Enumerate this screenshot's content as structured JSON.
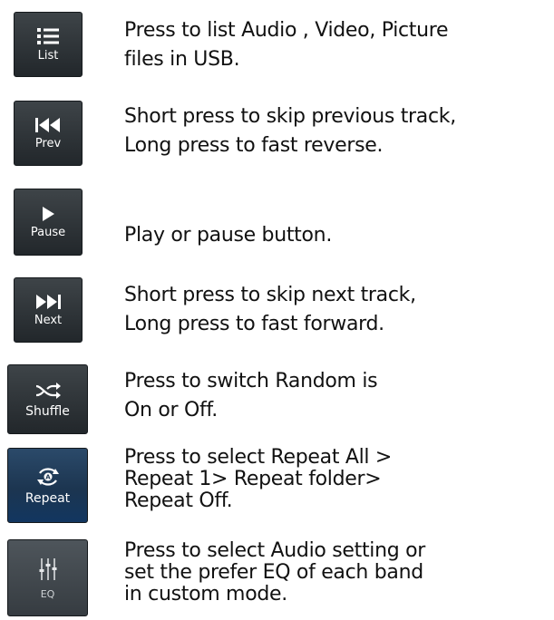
{
  "rows": [
    {
      "label": "List",
      "icon": "list-icon",
      "lines": [
        "Press to list Audio , Video, Picture",
        "files in USB."
      ]
    },
    {
      "label": "Prev",
      "icon": "skip-previous-icon",
      "lines": [
        "Short press to skip previous track,",
        "Long press to fast reverse."
      ]
    },
    {
      "label": "Pause",
      "icon": "play-icon",
      "lines": [
        "Play or pause button."
      ]
    },
    {
      "label": "Next",
      "icon": "skip-next-icon",
      "lines": [
        "Short press to skip next track,",
        "Long press to fast forward."
      ]
    },
    {
      "label": "Shuffle",
      "icon": "shuffle-icon",
      "lines": [
        "Press to switch Random is",
        "On or Off."
      ]
    },
    {
      "label": "Repeat",
      "icon": "repeat-icon",
      "lines": [
        "Press to select Repeat All >",
        "Repeat 1> Repeat folder>",
        "Repeat Off."
      ]
    },
    {
      "label": "EQ",
      "icon": "equalizer-icon",
      "lines": [
        "Press to select Audio setting or",
        "set the prefer EQ of each band",
        "in custom mode."
      ]
    }
  ],
  "colors": {
    "button_bg": "#2a3035",
    "button_active_bg": "#1c3550",
    "text": "#111111"
  }
}
